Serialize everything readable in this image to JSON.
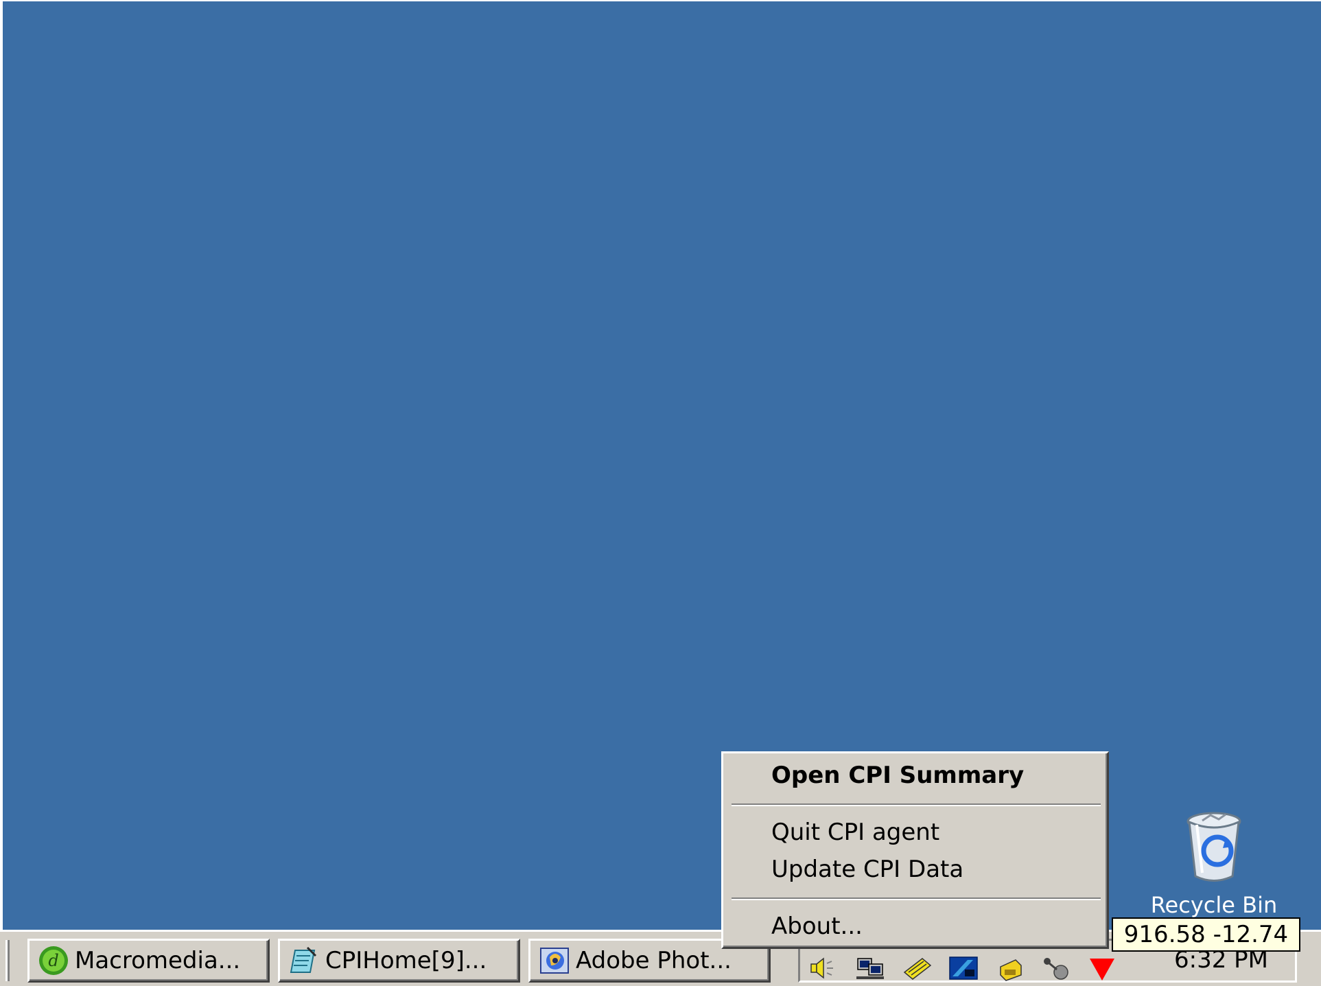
{
  "desktop": {
    "background_color": "#3b6ea5",
    "recycle_bin": {
      "label": "Recycle Bin",
      "icon": "recycle-bin-icon"
    }
  },
  "taskbar": {
    "buttons": [
      {
        "label": "Macromedia...",
        "icon": "dreamweaver-icon"
      },
      {
        "label": "CPIHome[9]...",
        "icon": "notepad-document-icon"
      },
      {
        "label": "Adobe Phot...",
        "icon": "adobe-photoshop-icon"
      }
    ],
    "tray_icons": [
      "volume-icon",
      "network-computers-icon",
      "pen-tablet-icon",
      "display-settings-icon",
      "yellow-app-icon",
      "network-connection-icon",
      "cpi-agent-red-arrow-icon"
    ],
    "clock": "6:32 PM"
  },
  "context_menu": {
    "items": [
      {
        "label": "Open CPI Summary",
        "default": true
      },
      {
        "label": "Quit CPI agent"
      },
      {
        "label": "Update CPI Data"
      },
      {
        "label": "About..."
      }
    ]
  },
  "tooltip": {
    "text": "916.58 -12.74"
  },
  "colors": {
    "taskbar_face": "#d4d0c8",
    "tooltip_bg": "#ffffe1",
    "cpi_arrow": "#ff0000"
  }
}
